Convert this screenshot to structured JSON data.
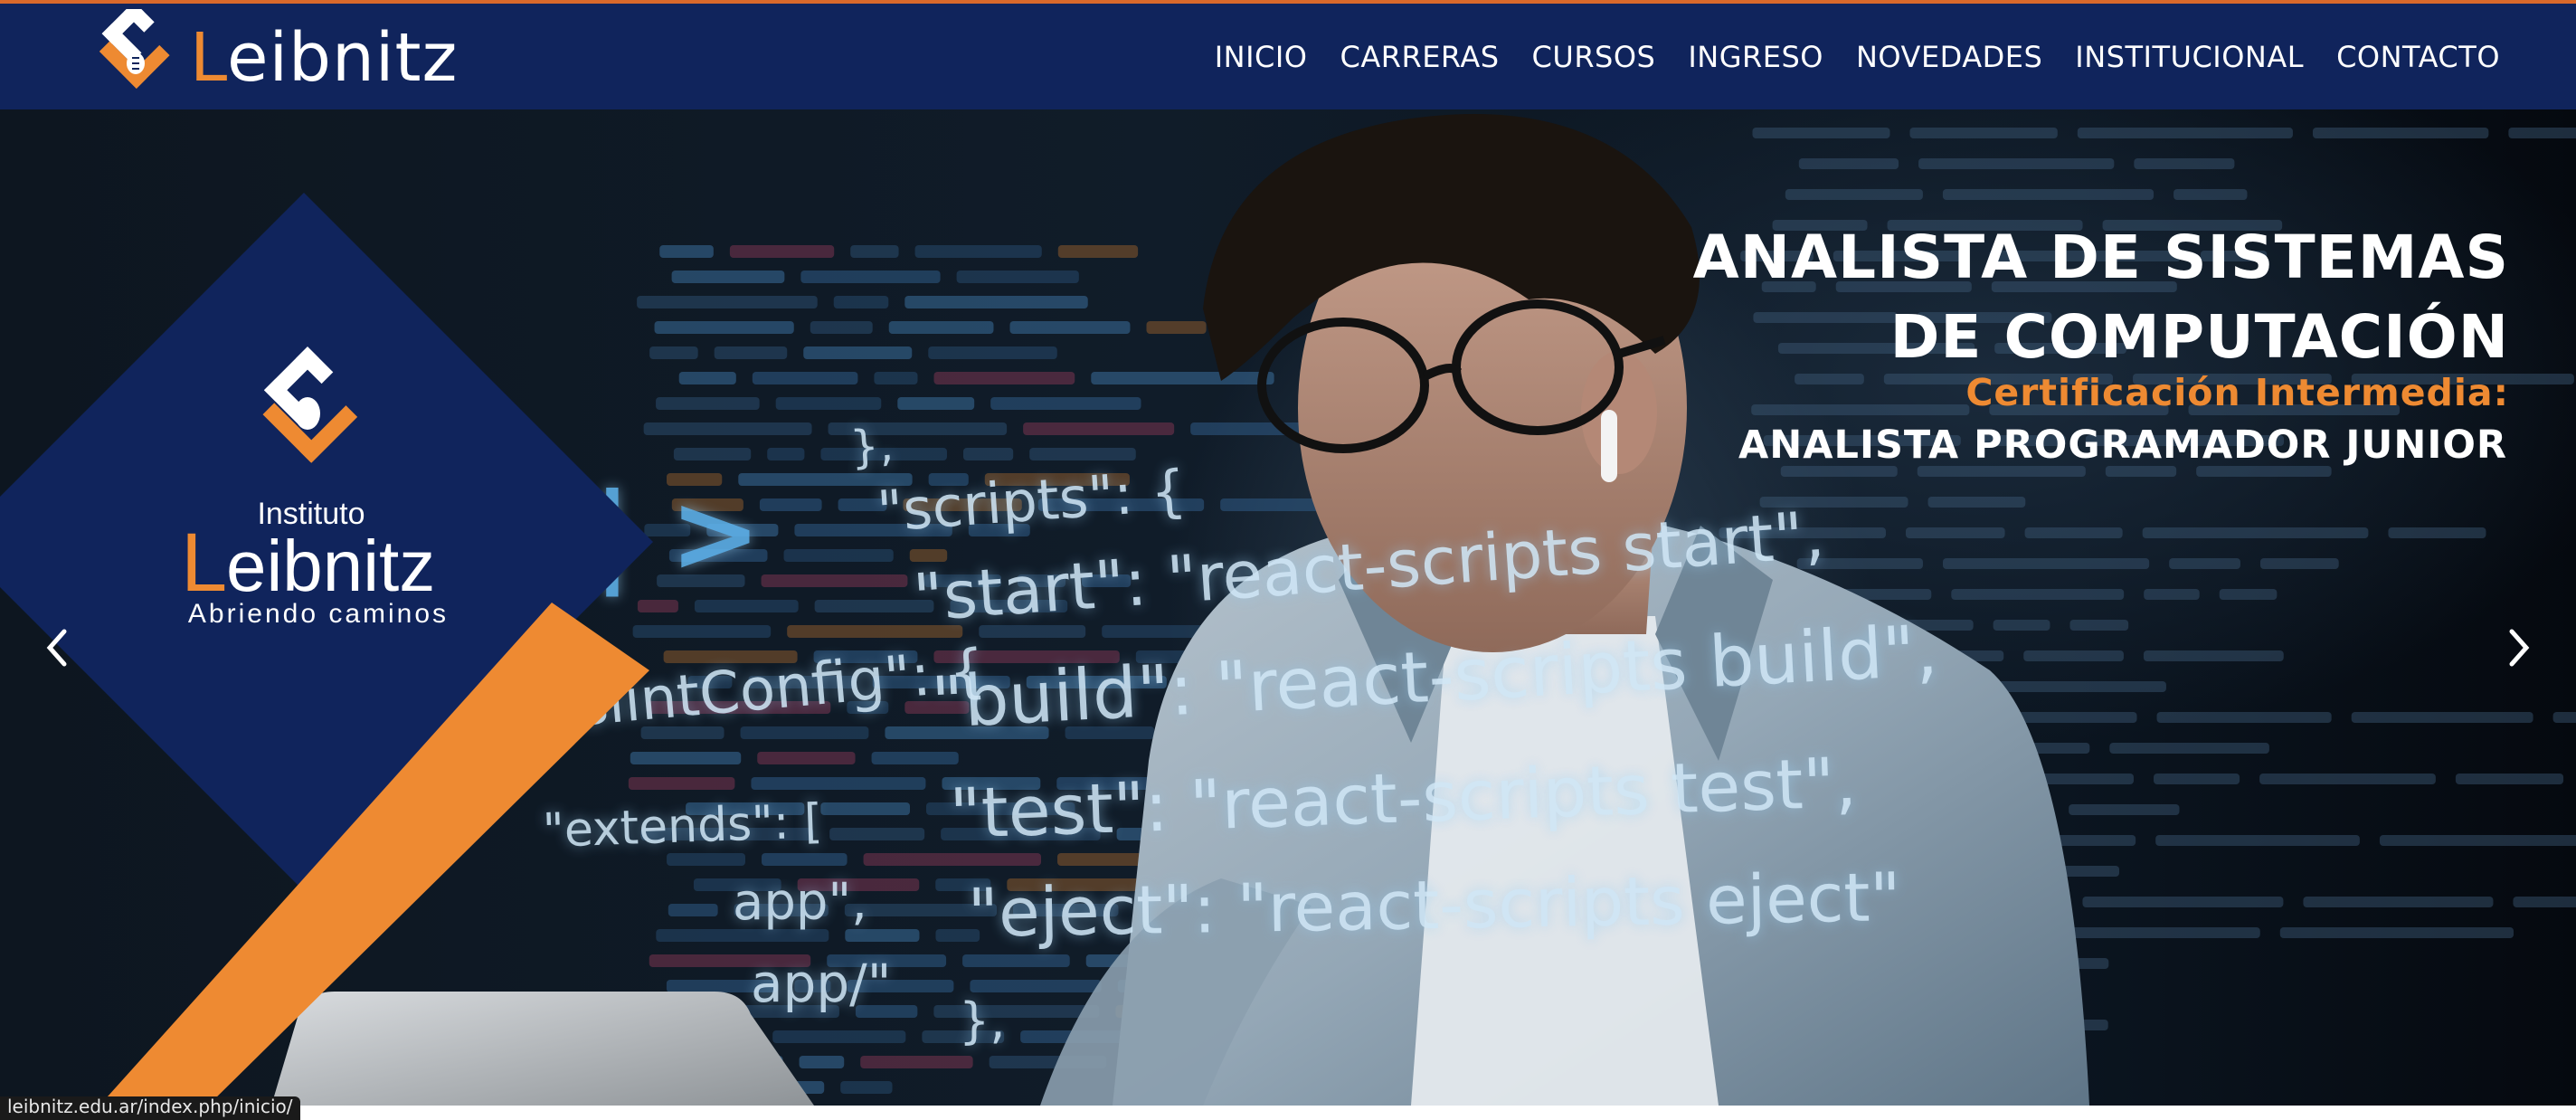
{
  "header": {
    "brand_initial": "L",
    "brand_rest": "eibnitz",
    "menu": [
      "INICIO",
      "CARRERAS",
      "CURSOS",
      "INGRESO",
      "NOVEDADES",
      "INSTITUCIONAL",
      "CONTACTO"
    ]
  },
  "hero": {
    "logo": {
      "institute_label": "Instituto",
      "name_initial": "L",
      "name_rest": "eibnitz",
      "tagline": "Abriendo caminos"
    },
    "title_line1": "ANALISTA DE SISTEMAS",
    "title_line2": "DE COMPUTACIÓN",
    "certification": "Certificación Intermedia:",
    "subtitle": "ANALISTA PROGRAMADOR JUNIOR",
    "code_lines": [
      "},",
      "\"scripts\": {",
      "\"start\": \"react-scripts start\",",
      "\"build\": \"react-scripts build\",",
      "\"test\": \"react-scripts test\",",
      "\"eject\": \"react-scripts eject\"",
      "},",
      "eslintConfig\": {",
      "\"extends\": [",
      "app\",",
      "app/\"",
      "| >"
    ],
    "prev_icon": "chevron-left-icon",
    "next_icon": "chevron-right-icon"
  },
  "status_url": "leibnitz.edu.ar/index.php/inicio/",
  "colors": {
    "navy": "#10245c",
    "orange": "#ee8a32",
    "white": "#ffffff"
  }
}
